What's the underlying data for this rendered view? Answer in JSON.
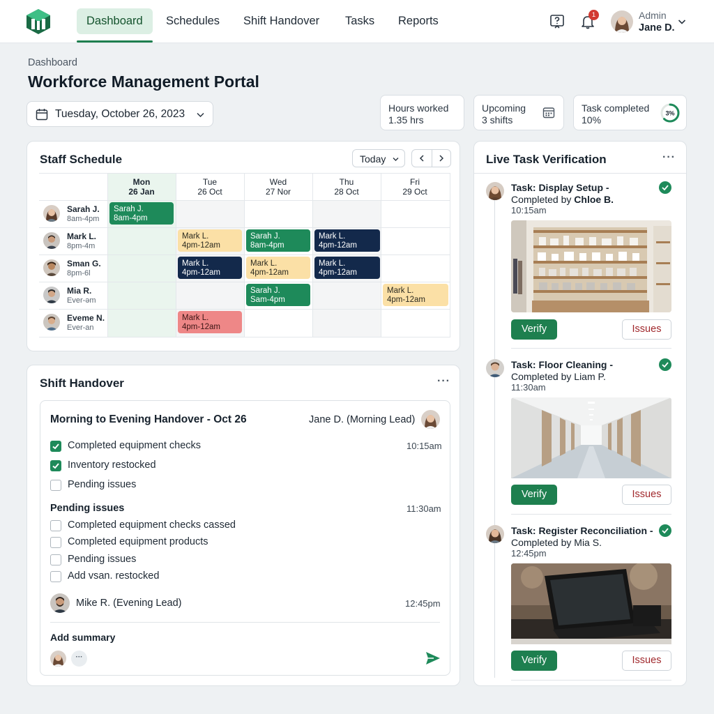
{
  "nav": {
    "tabs": [
      {
        "label": "Dashboard",
        "active": true
      },
      {
        "label": "Schedules"
      },
      {
        "label": "Shift Handover"
      },
      {
        "label": "Tasks"
      },
      {
        "label": "Reports"
      }
    ],
    "icons": [
      "help-icon",
      "bell-icon"
    ],
    "notification_count": "1",
    "user": {
      "role": "Admin",
      "name": "Jane D."
    }
  },
  "header": {
    "breadcrumb": "Dashboard",
    "title": "Workforce Management Portal",
    "date": "Tuesday, October 26, 2023"
  },
  "stats": [
    {
      "line1": "Hours worked",
      "line2": "1.35 hrs"
    },
    {
      "line1": "Upcoming",
      "line2": "3 shifts"
    },
    {
      "line1": "Task completed",
      "line2": "10%",
      "ring_label": "3%",
      "progress": 0.1
    }
  ],
  "schedule": {
    "title": "Staff Schedule",
    "today_label": "Today",
    "days": [
      {
        "name": "Mon",
        "date": "26 Jan"
      },
      {
        "name": "Tue",
        "date": "26 Oct"
      },
      {
        "name": "Wed",
        "date": "27 Nor"
      },
      {
        "name": "Thu",
        "date": "28 Oct"
      },
      {
        "name": "Fri",
        "date": "29 Oct"
      }
    ],
    "staff": [
      {
        "name": "Sarah J.",
        "hours": "8am-4pm"
      },
      {
        "name": "Mark L.",
        "hours": "8pm-4m"
      },
      {
        "name": "Sman G.",
        "hours": "8pm-6l"
      },
      {
        "name": "Mia R.",
        "hours": "Ever-əm"
      },
      {
        "name": "Eveme N.",
        "hours": "Ever-an"
      }
    ],
    "shifts": [
      {
        "name": "Sarah J.",
        "time": "8am-4pm",
        "color": "green"
      },
      {
        "name": "Mark L.",
        "time": "4pm-12am",
        "color": "yellow"
      },
      {
        "name": "Sarah J.",
        "time": "8am-4pm",
        "color": "green"
      },
      {
        "name": "Mark L.",
        "time": "4pm-12am",
        "color": "navy"
      },
      {
        "name": "Mark L.",
        "time": "4pm-12am",
        "color": "navy"
      },
      {
        "name": "Mark L.",
        "time": "4pm-12am",
        "color": "yellow"
      },
      {
        "name": "Mark L.",
        "time": "4pm-12am",
        "color": "navy"
      },
      {
        "name": "Sarah J.",
        "time": "Sam-4pm",
        "color": "green"
      },
      {
        "name": "Mark L.",
        "time": "4pm-12am",
        "color": "yellow"
      },
      {
        "name": "Mark L.",
        "time": "4pm-12am",
        "color": "red"
      }
    ]
  },
  "handover": {
    "title": "Shift Handover",
    "heading": "Morning to Evening Handover - Oct 26",
    "lead": "Jane D. (Morning Lead)",
    "items": [
      {
        "label": "Completed equipment checks",
        "checked": true,
        "time": "10:15am"
      },
      {
        "label": "Inventory restocked",
        "checked": true
      },
      {
        "label": "Pending issues",
        "checked": false
      }
    ],
    "pending_title": "Pending issues",
    "pending_time": "11:30am",
    "pending_items": [
      "Completed equipment checks cassed",
      "Completed equipment products",
      "Pending issues",
      "Add vsan. restocked"
    ],
    "evening_lead": "Mike R. (Evening Lead)",
    "evening_time": "12:45pm",
    "summary_label": "Add summary"
  },
  "live": {
    "title": "Live Task Verification",
    "tasks": [
      {
        "prefix": "Task:",
        "task": "Display Setup -",
        "by_prefix": "Completed by",
        "by": "Chloe B.",
        "time": "10:15am"
      },
      {
        "prefix": "Task:",
        "task": "Floor Cleaning -",
        "by_prefix": "Completed by",
        "by": "Liam P.",
        "time": "11:30am"
      },
      {
        "prefix": "Task:",
        "task": "Register Reconciliation -",
        "by_prefix": "Completed by",
        "by": "Mia S.",
        "time": "12:45pm"
      }
    ],
    "verify_label": "Verify",
    "issues_label": "Issues"
  },
  "colors": {
    "accent": "#1e7f4f",
    "shift_green": "#1e8a5a",
    "shift_yellow": "#fbe0a6",
    "shift_navy": "#13294b",
    "shift_red": "#ee8787",
    "issue_text": "#a0282c"
  }
}
